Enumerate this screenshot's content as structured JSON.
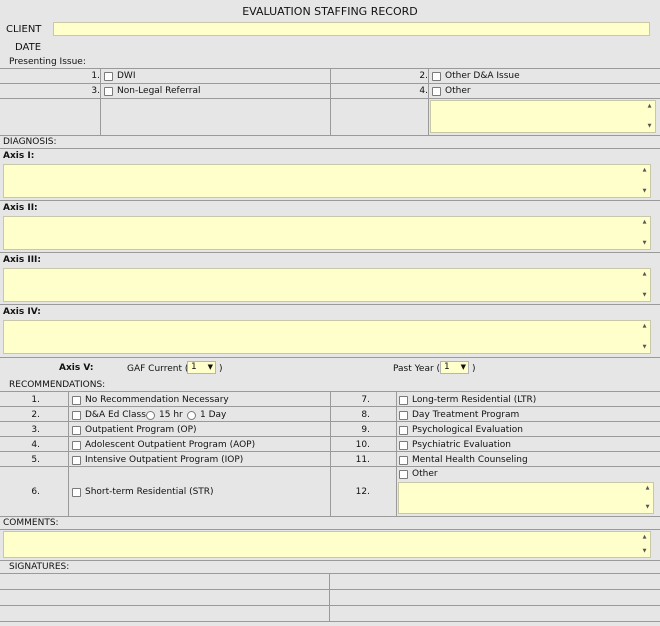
{
  "form": {
    "title": "EVALUATION STAFFING RECORD",
    "client_label": "CLIENT",
    "date_label": "DATE",
    "client_value": "",
    "date_value": ""
  },
  "presenting": {
    "label": "Presenting Issue:",
    "items": [
      {
        "num": "1.",
        "label": "DWI"
      },
      {
        "num": "2.",
        "label": "Other D&A Issue"
      },
      {
        "num": "3.",
        "label": "Non-Legal Referral"
      },
      {
        "num": "4.",
        "label": "Other"
      }
    ]
  },
  "diagnosis": {
    "label": "DIAGNOSIS:",
    "axes": [
      {
        "label": "Axis I:"
      },
      {
        "label": "Axis II:"
      },
      {
        "label": "Axis III:"
      },
      {
        "label": "Axis IV:"
      }
    ],
    "axis5_label": "Axis V:",
    "gaf_current_label": "GAF Current (",
    "gaf_current_value": "1",
    "gaf_close": ")",
    "past_year_label": "Past Year (",
    "past_year_value": "1",
    "past_close": ")"
  },
  "recommendations": {
    "label": "RECOMMENDATIONS:",
    "left": [
      {
        "num": "1.",
        "label": "No Recommendation Necessary"
      },
      {
        "num": "2.",
        "label": "D&A Ed Class"
      },
      {
        "num": "3.",
        "label": "Outpatient Program (OP)"
      },
      {
        "num": "4.",
        "label": "Adolescent Outpatient Program (AOP)"
      },
      {
        "num": "5.",
        "label": "Intensive Outpatient Program (IOP)"
      },
      {
        "num": "6.",
        "label": "Short-term Residential (STR)"
      }
    ],
    "ed_class_opt1": "15 hr",
    "ed_class_opt2": "1 Day",
    "right": [
      {
        "num": "7.",
        "label": "Long-term Residential (LTR)"
      },
      {
        "num": "8.",
        "label": "Day Treatment Program"
      },
      {
        "num": "9.",
        "label": "Psychological Evaluation"
      },
      {
        "num": "10.",
        "label": "Psychiatric Evaluation"
      },
      {
        "num": "11.",
        "label": "Mental Health Counseling"
      },
      {
        "num": "12.",
        "label": "Other"
      }
    ]
  },
  "comments": {
    "label": "COMMENTS:"
  },
  "signatures": {
    "label": "SIGNATURES:"
  }
}
